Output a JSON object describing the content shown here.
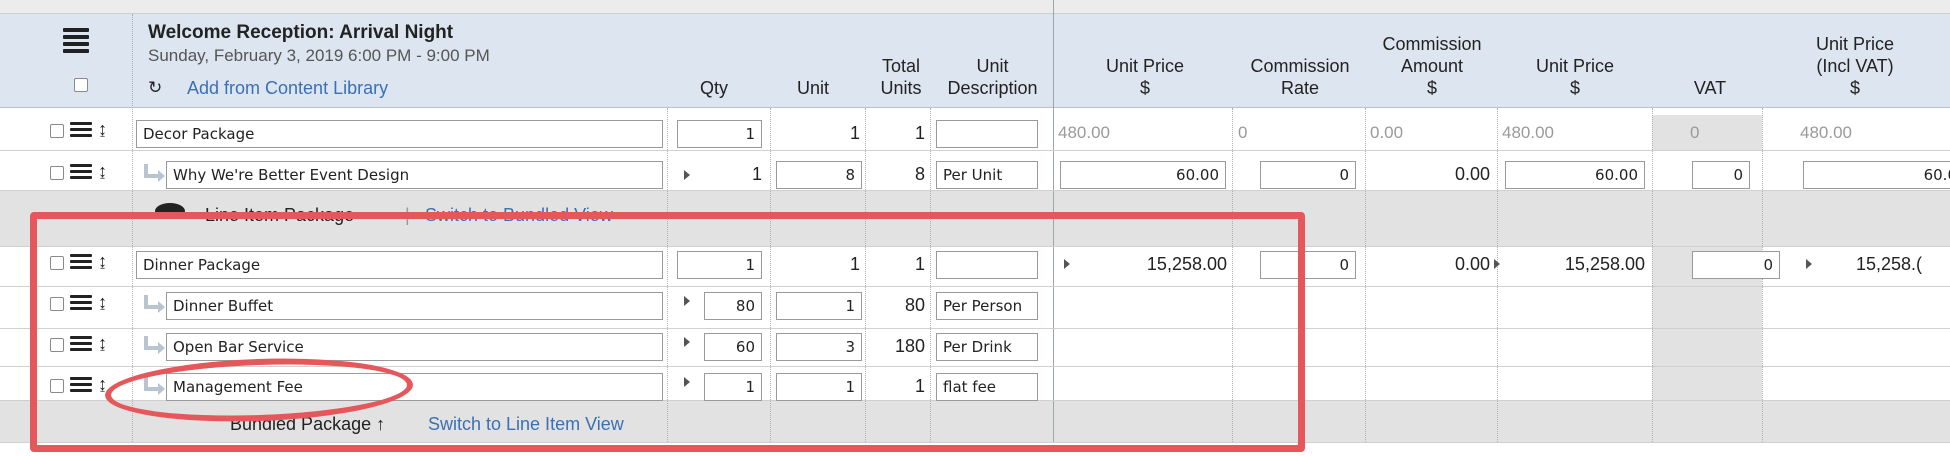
{
  "section": {
    "title": "Welcome Reception: Arrival Night",
    "subtitle": "Sunday, February 3, 2019 6:00 PM - 9:00 PM",
    "add_link": "Add from Content Library"
  },
  "columns": {
    "qty": "Qty",
    "unit": "Unit",
    "total_units_1": "Total",
    "total_units_2": "Units",
    "unit_desc_1": "Unit",
    "unit_desc_2": "Description",
    "unit_price_1": "Unit Price",
    "unit_price_1_cur": "$",
    "commission_rate_1": "Commission",
    "commission_rate_2": "Rate",
    "commission_amount_1": "Commission",
    "commission_amount_2": "Amount",
    "commission_amount_cur": "$",
    "unit_price_2": "Unit Price",
    "unit_price_2_cur": "$",
    "vat": "VAT",
    "unit_price_incl_1": "Unit Price",
    "unit_price_incl_2": "(Incl VAT)",
    "unit_price_incl_cur": "$"
  },
  "rows": {
    "decor": {
      "name": "Decor Package",
      "qty": "1",
      "unit": "1",
      "total": "1",
      "desc": "",
      "unit_price": "480.00",
      "commission_rate": "0",
      "commission_amount": "0.00",
      "unit_price_2": "480.00",
      "vat": "0",
      "unit_price_incl": "480.00"
    },
    "design": {
      "name": "Why We're Better Event Design",
      "qty": "1",
      "unit": "8",
      "total": "8",
      "desc": "Per Unit",
      "unit_price": "60.00",
      "commission_rate": "0",
      "commission_amount": "0.00",
      "unit_price_2": "60.00",
      "vat": "0",
      "unit_price_incl": "60.0"
    },
    "dinner": {
      "name": "Dinner Package",
      "qty": "1",
      "unit": "1",
      "total": "1",
      "desc": "",
      "unit_price": "15,258.00",
      "commission_rate": "0",
      "commission_amount": "0.00",
      "unit_price_2": "15,258.00",
      "vat": "0",
      "unit_price_incl": "15,258.("
    },
    "buffet": {
      "name": "Dinner Buffet",
      "qty": "80",
      "unit": "1",
      "total": "80",
      "desc": "Per Person"
    },
    "bar": {
      "name": "Open Bar Service",
      "qty": "60",
      "unit": "3",
      "total": "180",
      "desc": "Per Drink"
    },
    "mgmt": {
      "name": "Management Fee",
      "qty": "1",
      "unit": "1",
      "total": "1",
      "desc": "flat fee"
    }
  },
  "line_item_package": {
    "label": "Line Item Package",
    "sep": "|",
    "link": "Switch to Bundled View"
  },
  "bundled_package": {
    "label": "Bundled Package ↑",
    "link": "Switch to Line Item View"
  },
  "highlight_color": "#e5575a",
  "accent_color": "#3b6fb6"
}
